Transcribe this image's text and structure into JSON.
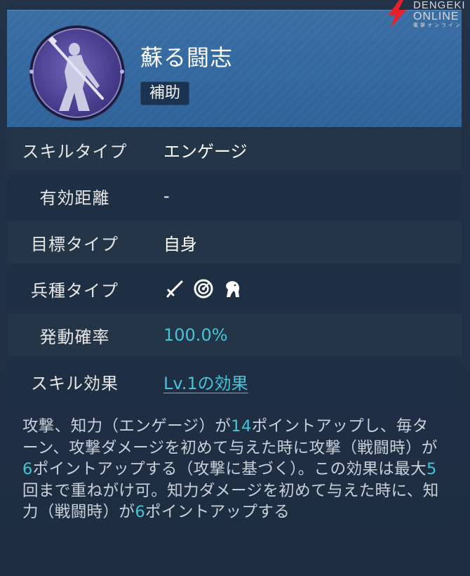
{
  "skill": {
    "name": "蘇る闘志",
    "category": "補助"
  },
  "logo": {
    "line1": "DENGEKI",
    "line2": "ONLINE",
    "line3": "電撃オンライン"
  },
  "rows": [
    {
      "label": "スキルタイプ",
      "value": "エンゲージ"
    },
    {
      "label": "有効距離",
      "value": "-"
    },
    {
      "label": "目標タイプ",
      "value": "自身"
    },
    {
      "label": "兵種タイプ",
      "icons": [
        "sword-icon",
        "target-icon",
        "horse-icon"
      ]
    },
    {
      "label": "発動確率",
      "value": "100.0%"
    },
    {
      "label": "スキル効果",
      "value": "Lv.1の効果"
    }
  ],
  "description": {
    "parts": [
      "攻撃、知力（エンゲージ）が",
      "14",
      "ポイントアップし、毎ターン、攻撃ダメージを初めて与えた時に攻撃（戦闘時）が",
      "6",
      "ポイントアップする（攻撃に基づく）。この効果は最大",
      "5",
      "回まで重ねがけ可。知力ダメージを初めて与えた時に、知力（戦闘時）が",
      "6",
      "ポイントアップする"
    ]
  },
  "colors": {
    "accent": "#46c3d6",
    "header": "#3368a0",
    "portrait": "#4a3f8f"
  }
}
